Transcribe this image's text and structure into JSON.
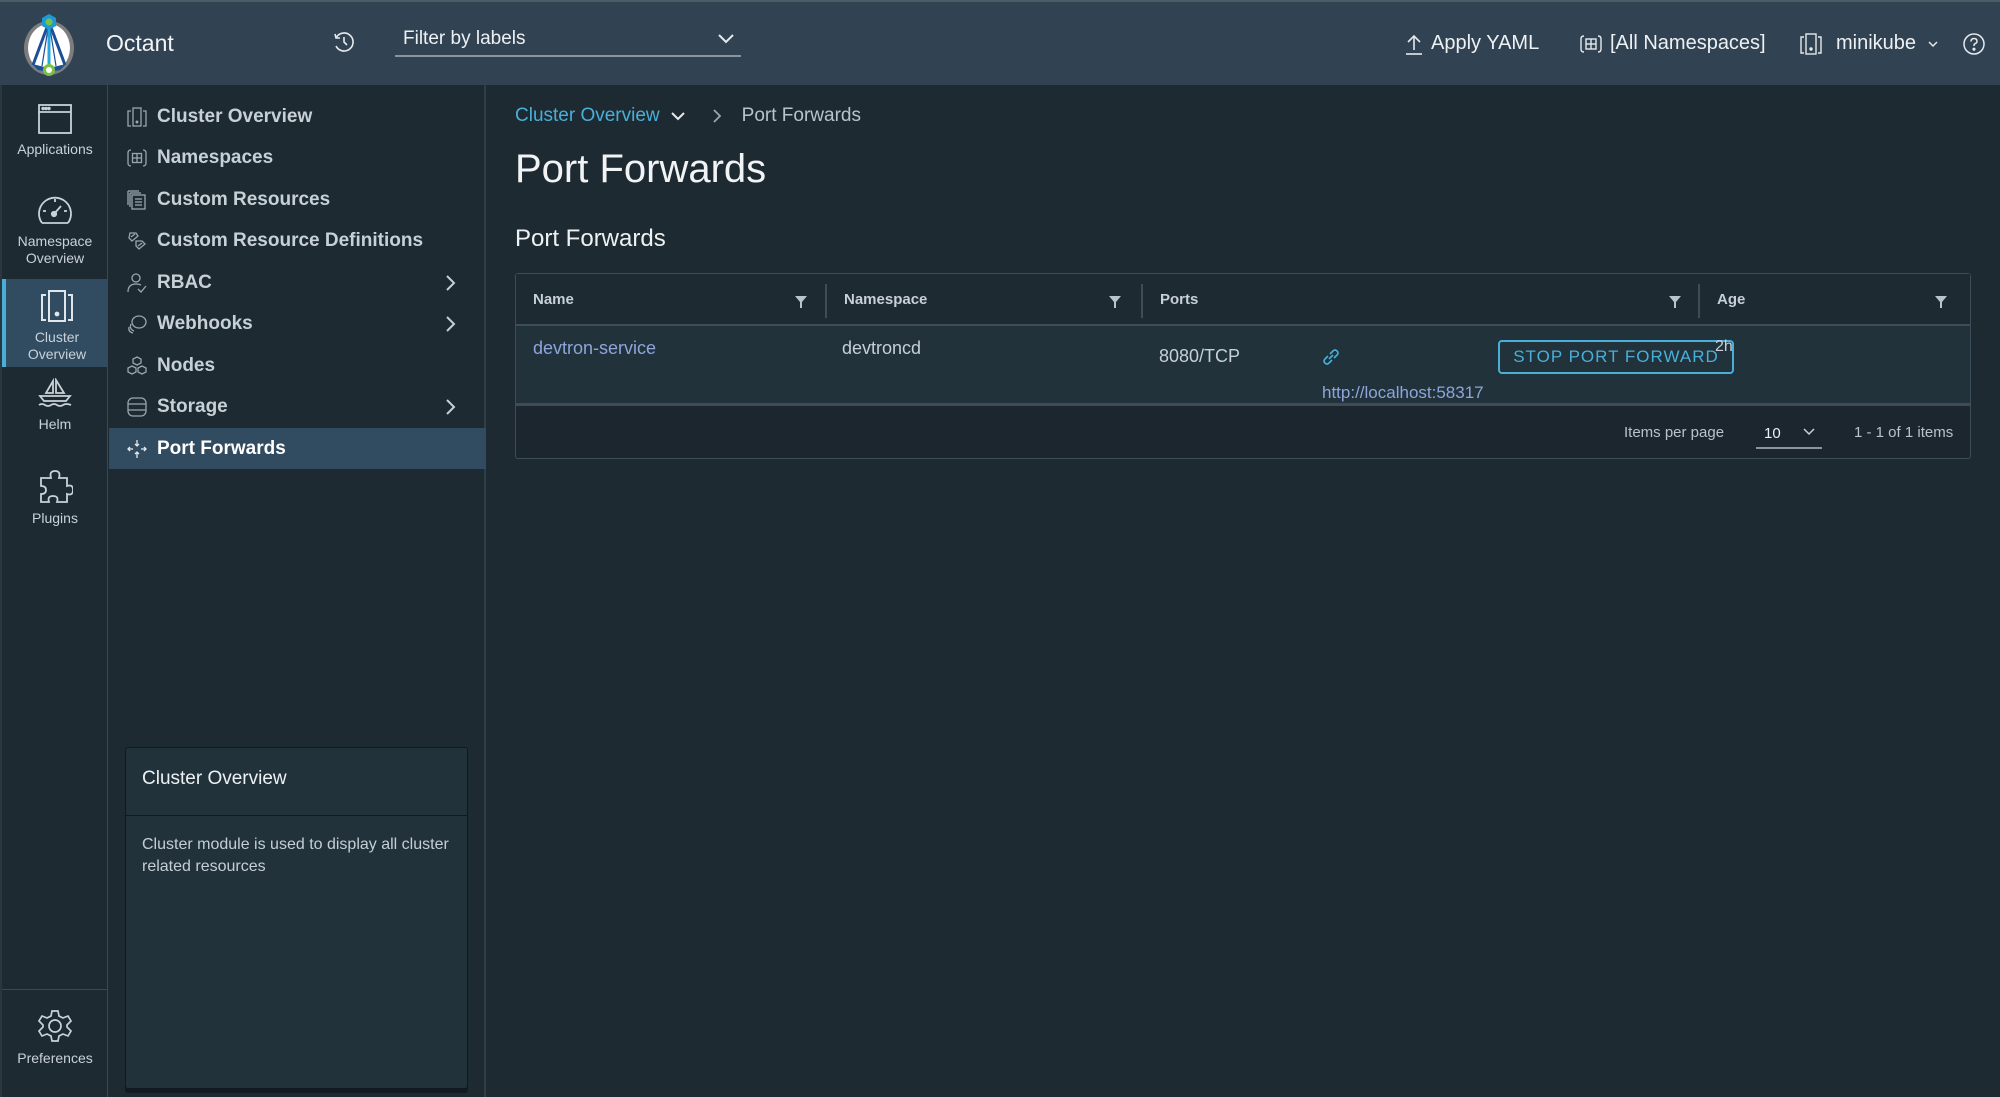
{
  "header": {
    "app_title": "Octant",
    "filter_placeholder": "Filter by labels",
    "apply_yaml_label": "Apply YAML",
    "namespace_label": "[All Namespaces]",
    "context_label": "minikube"
  },
  "vnav": {
    "items": [
      {
        "label": "Applications",
        "icon": "browser-window-icon"
      },
      {
        "label_line1": "Namespace",
        "label_line2": "Overview",
        "icon": "dashboard-gauge-icon"
      },
      {
        "label_line1": "Cluster",
        "label_line2": "Overview",
        "icon": "cluster-icon",
        "active": true
      },
      {
        "label": "Helm",
        "icon": "sailboat-icon"
      },
      {
        "label": "Plugins",
        "icon": "puzzle-piece-icon"
      }
    ],
    "preferences_label": "Preferences"
  },
  "snav": {
    "items": [
      {
        "label": "Cluster Overview",
        "icon": "cluster-icon"
      },
      {
        "label": "Namespaces",
        "icon": "namespace-icon"
      },
      {
        "label": "Custom Resources",
        "icon": "stacked-documents-icon"
      },
      {
        "label": "Custom Resource Definitions",
        "icon": "crd-icon"
      },
      {
        "label": "RBAC",
        "icon": "user-check-icon",
        "expandable": true
      },
      {
        "label": "Webhooks",
        "icon": "webhook-icon",
        "expandable": true
      },
      {
        "label": "Nodes",
        "icon": "nodes-hexagon-icon"
      },
      {
        "label": "Storage",
        "icon": "database-icon",
        "expandable": true
      },
      {
        "label": "Port Forwards",
        "icon": "port-forward-arrows-icon",
        "active": true
      }
    ],
    "help_card": {
      "title": "Cluster Overview",
      "body": "Cluster module is used to display all cluster related resources"
    }
  },
  "main": {
    "breadcrumb": {
      "parent": "Cluster Overview",
      "current": "Port Forwards"
    },
    "page_title": "Port Forwards",
    "section_title": "Port Forwards",
    "table": {
      "columns": [
        "Name",
        "Namespace",
        "Ports",
        "Age"
      ],
      "rows": [
        {
          "name": "devtron-service",
          "namespace": "devtroncd",
          "port": "8080/TCP",
          "url": "http://localhost:58317",
          "action": "STOP PORT FORWARD",
          "age": "2h"
        }
      ],
      "footer": {
        "items_per_page_label": "Items per page",
        "items_per_page_value": "10",
        "page_info": "1 - 1 of 1 items"
      }
    }
  },
  "colors": {
    "header_bg": "#314253",
    "body_bg": "#1e2a32",
    "accent": "#49afd9",
    "active_nav_bg": "#314b60",
    "link": "#8ea5dc"
  }
}
